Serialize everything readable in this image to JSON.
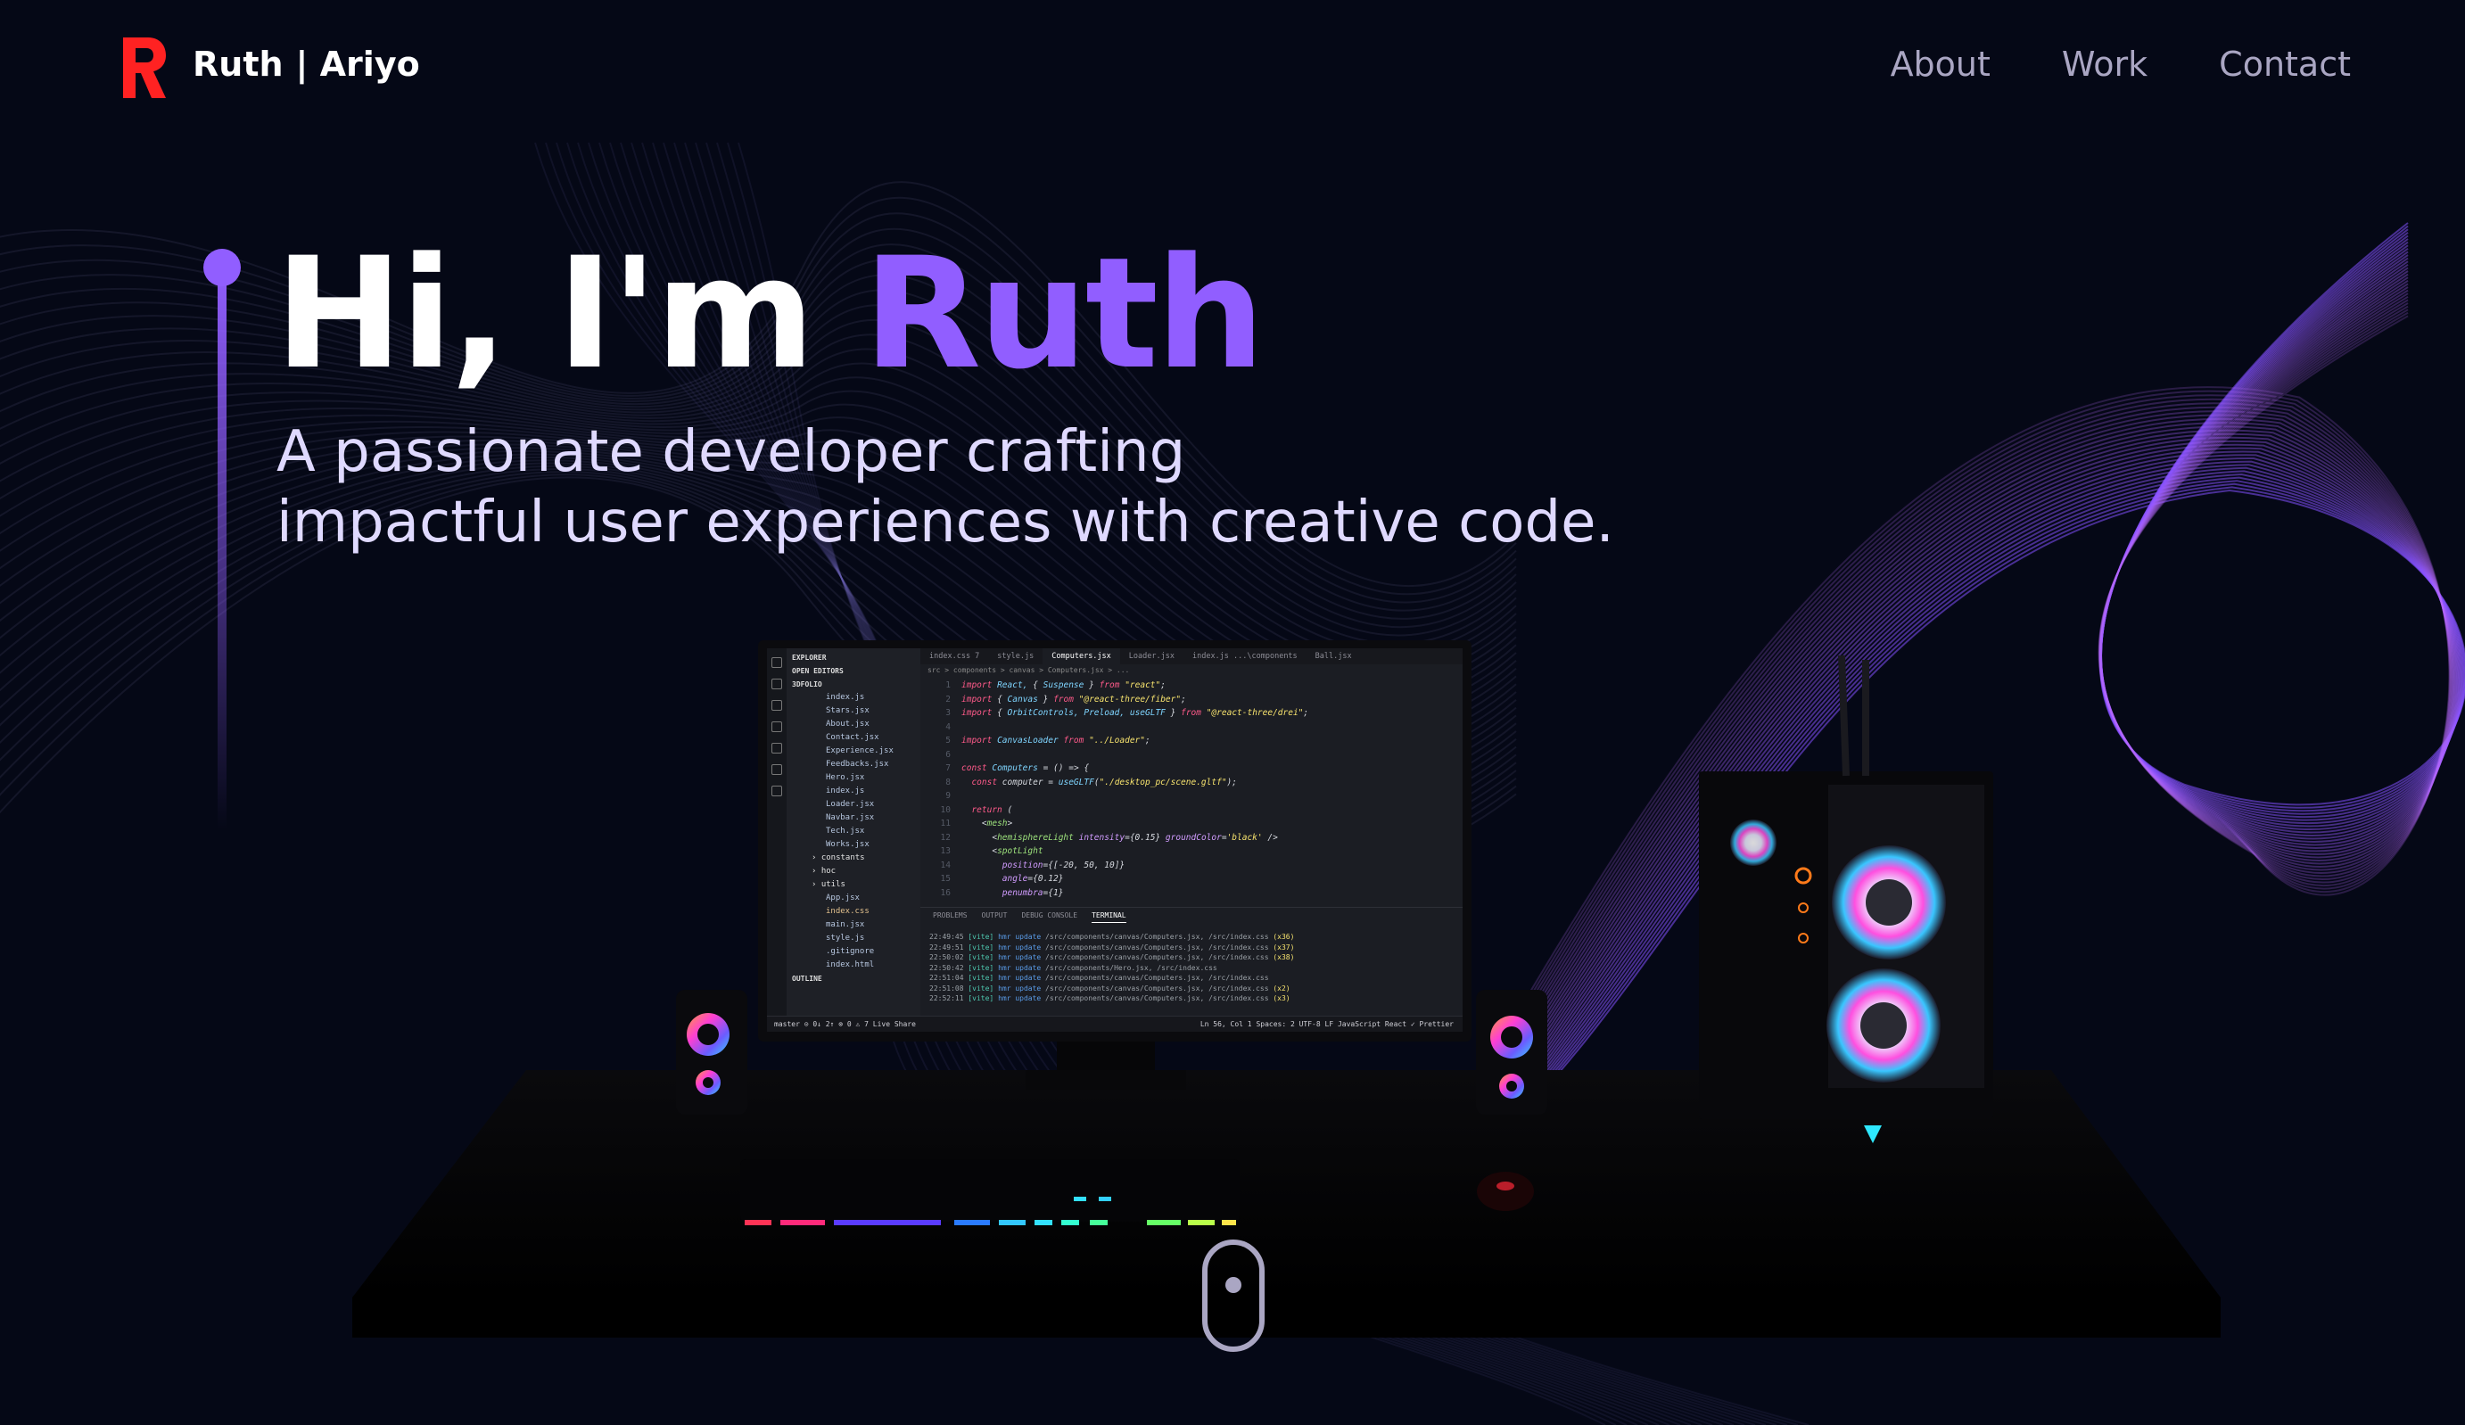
{
  "brand": {
    "name": "Ruth",
    "surname": "| Ariyo",
    "logo_letter": "R",
    "logo_color": "#ff2222"
  },
  "nav": {
    "items": [
      "About",
      "Work",
      "Contact"
    ]
  },
  "hero": {
    "greeting": "Hi, I'm ",
    "name": "Ruth",
    "subtitle_line1": "A passionate developer crafting",
    "subtitle_line2": "impactful user experiences with creative code.",
    "accent_color": "#915eff"
  },
  "editor": {
    "explorer_title": "EXPLORER",
    "open_editors": "OPEN EDITORS",
    "project": "3DFOLIO",
    "files": [
      "index.js",
      "Stars.jsx",
      "About.jsx",
      "Contact.jsx",
      "Experience.jsx",
      "Feedbacks.jsx",
      "Hero.jsx",
      "index.js",
      "Loader.jsx",
      "Navbar.jsx",
      "Tech.jsx",
      "Works.jsx"
    ],
    "folders": [
      "constants",
      "hoc",
      "utils"
    ],
    "root_files": [
      "App.jsx",
      "index.css",
      "main.jsx",
      "style.js",
      ".gitignore",
      "index.html"
    ],
    "outline": "OUTLINE",
    "tabs": [
      "index.css 7",
      "style.js",
      "Computers.jsx",
      "Loader.jsx",
      "index.js ...\\components",
      "Ball.jsx"
    ],
    "breadcrumb": "src > components > canvas > Computers.jsx > ...",
    "code": [
      "import React, { Suspense } from \"react\";",
      "import { Canvas } from \"@react-three/fiber\";",
      "import { OrbitControls, Preload, useGLTF } from \"@react-three/drei\";",
      "",
      "import CanvasLoader from \"../Loader\";",
      "",
      "const Computers = () => {",
      "  const computer = useGLTF(\"./desktop_pc/scene.gltf\");",
      "",
      "  return (",
      "    <mesh>",
      "      <hemisphereLight intensity={0.15} groundColor='black' />",
      "      <spotLight",
      "        position={[-20, 50, 10]}",
      "        angle={0.12}",
      "        penumbra={1}"
    ],
    "panel_tabs": [
      "PROBLEMS",
      "OUTPUT",
      "DEBUG CONSOLE",
      "TERMINAL"
    ],
    "terminal": [
      "22:49:45 [vite] hmr update /src/components/canvas/Computers.jsx, /src/index.css (x36)",
      "22:49:51 [vite] hmr update /src/components/canvas/Computers.jsx, /src/index.css (x37)",
      "22:50:02 [vite] hmr update /src/components/canvas/Computers.jsx, /src/index.css (x38)",
      "22:50:42 [vite] hmr update /src/components/Hero.jsx, /src/index.css",
      "22:51:04 [vite] hmr update /src/components/canvas/Computers.jsx, /src/index.css",
      "22:51:08 [vite] hmr update /src/components/canvas/Computers.jsx, /src/index.css (x2)",
      "22:52:11 [vite] hmr update /src/components/canvas/Computers.jsx, /src/index.css (x3)"
    ],
    "status_left": "master   ⊙ 0↓ 2↑   ⊗ 0 ⚠ 7   Live Share",
    "status_right": "Ln 56, Col 1   Spaces: 2   UTF-8   LF   JavaScript React   ✓ Prettier"
  },
  "icons": {
    "scroll": "mouse-scroll-icon",
    "logo": "r-logo-icon"
  }
}
